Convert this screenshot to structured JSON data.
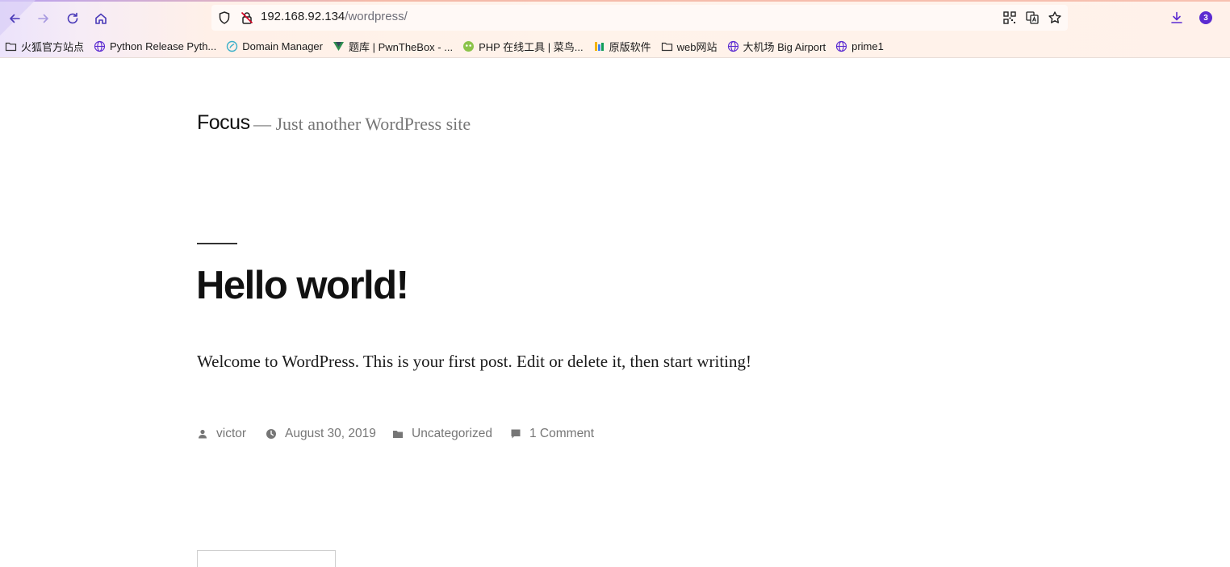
{
  "browser": {
    "url_host": "192.168.92.134",
    "url_path": "/wordpress/",
    "downloads_badge": "3",
    "bookmarks": [
      {
        "label": "火狐官方站点",
        "icon": "folder-icon"
      },
      {
        "label": "Python Release Pyth...",
        "icon": "globe-icon"
      },
      {
        "label": "Domain Manager",
        "icon": "domain-icon"
      },
      {
        "label": "题库 | PwnTheBox - ...",
        "icon": "v-logo-icon"
      },
      {
        "label": "PHP 在线工具 | 菜鸟...",
        "icon": "runoob-icon"
      },
      {
        "label": "原版软件",
        "icon": "software-icon"
      },
      {
        "label": "web网站",
        "icon": "folder-icon"
      },
      {
        "label": "大机场 Big Airport",
        "icon": "globe-icon"
      },
      {
        "label": "prime1",
        "icon": "globe-icon"
      }
    ],
    "accent_color": "#5b2bd1"
  },
  "site": {
    "title": "Focus",
    "description": "— Just another WordPress site"
  },
  "post": {
    "title": "Hello world!",
    "body": "Welcome to WordPress. This is your first post. Edit or delete it, then start writing!",
    "meta": {
      "author": "victor",
      "date": "August 30, 2019",
      "category": "Uncategorized",
      "comments": "1 Comment"
    }
  }
}
